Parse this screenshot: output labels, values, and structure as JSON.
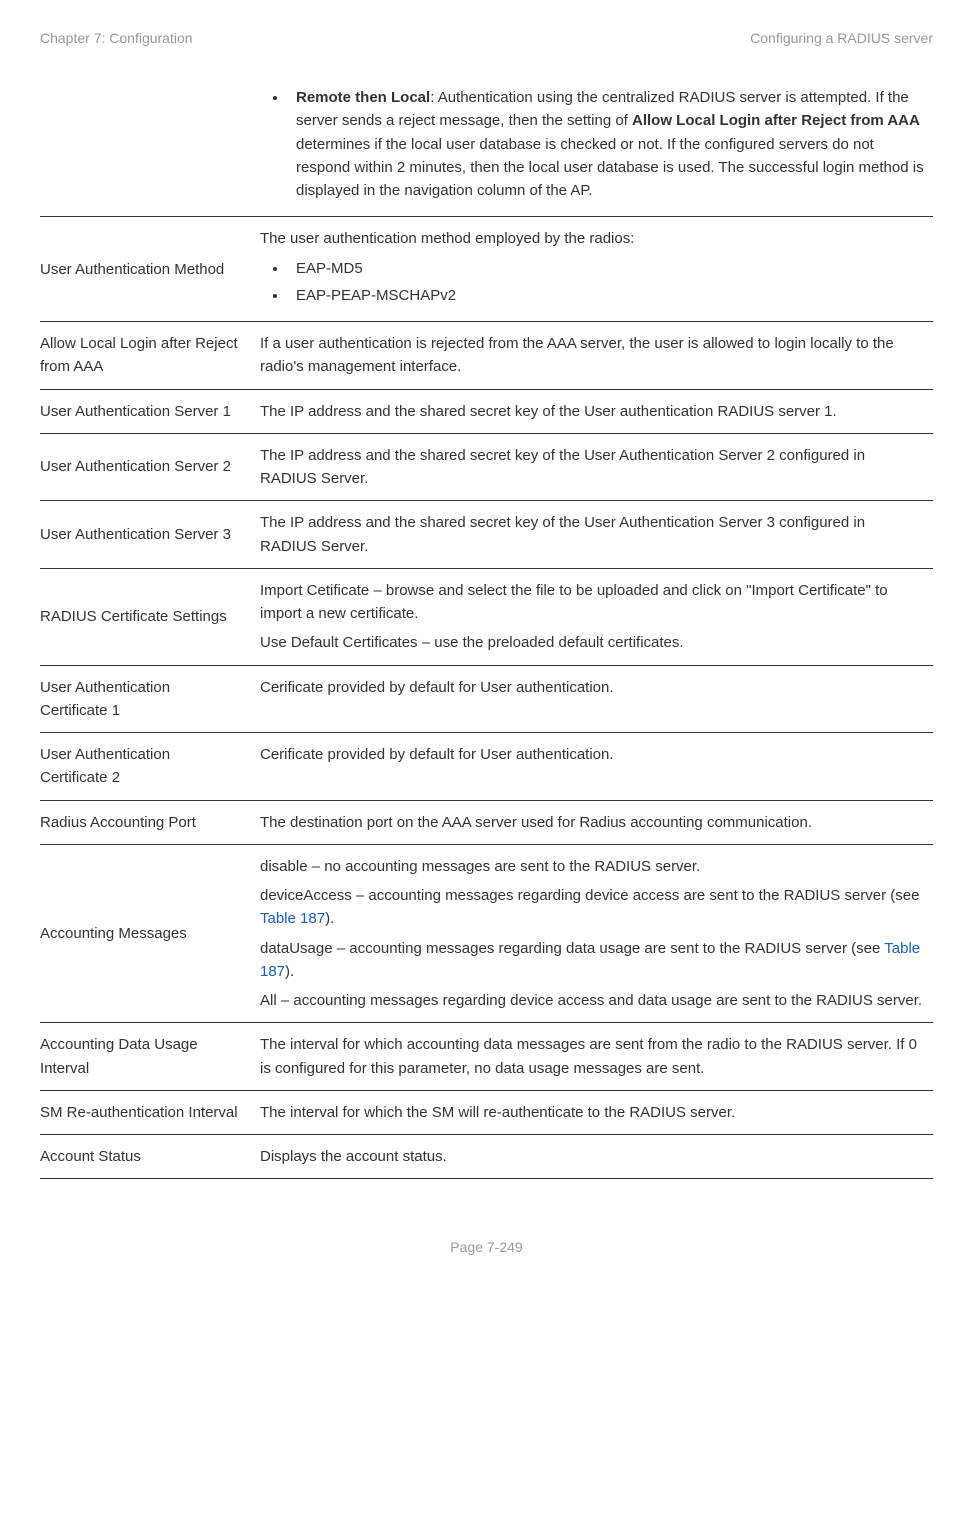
{
  "header": {
    "left": "Chapter 7:  Configuration",
    "right": "Configuring a RADIUS server"
  },
  "rows": {
    "r0": {
      "attr": "",
      "bullet_prefix_bold": "Remote then Local",
      "bullet_text": ": Authentication using the centralized RADIUS server is attempted. If the server sends a reject message, then the setting of ",
      "bullet_mid_bold": "Allow Local Login after Reject from AAA",
      "bullet_suffix": " determines if the local user database is checked or not. If the configured servers do not respond within 2 minutes, then the local user database is used. The successful login method is displayed in the navigation column of the AP."
    },
    "r1": {
      "attr": "User Authentication Method",
      "intro": "The user authentication method employed by the radios:",
      "b1": "EAP-MD5",
      "b2": "EAP-PEAP-MSCHAPv2"
    },
    "r2": {
      "attr": "Allow Local Login after Reject from AAA",
      "desc": "If a user authentication is rejected from the AAA server, the user is allowed to login locally to the radio's management interface."
    },
    "r3": {
      "attr": "User Authentication Server 1",
      "desc": "The IP address and the shared secret key of the User authentication RADIUS server 1."
    },
    "r4": {
      "attr": "User Authentication Server 2",
      "desc": "The IP address and the shared secret key of the User Authentication Server 2 configured in RADIUS Server."
    },
    "r5": {
      "attr": "User Authentication Server 3",
      "desc": "The IP address and the shared secret key of the User Authentication Server 3 configured in RADIUS Server."
    },
    "r6": {
      "attr": "RADIUS Certificate Settings",
      "p1": "Import Cetificate – browse and select the file to be uploaded and click on \"Import Certificate\" to import a new certificate.",
      "p2": "Use Default Certificates  –  use the preloaded default certificates."
    },
    "r7": {
      "attr": "User Authentication Certificate 1",
      "desc": "Cerificate provided by default for User authentication."
    },
    "r8": {
      "attr": "User Authentication Certificate 2",
      "desc": "Cerificate provided by default for User authentication."
    },
    "r9": {
      "attr": "Radius Accounting Port",
      "desc": "The destination port on the AAA server used for Radius accounting communication."
    },
    "r10": {
      "attr": "Accounting Messages",
      "p1": "disable – no accounting messages are sent to the RADIUS server.",
      "p2a": "deviceAccess – accounting messages regarding device access are sent to the RADIUS server (see ",
      "p2link": "Table 187",
      "p2b": ").",
      "p3a": "dataUsage – accounting messages regarding data usage are sent to the RADIUS server (see ",
      "p3link": "Table 187",
      "p3b": ").",
      "p4": "All – accounting messages regarding device access and data usage are sent to the RADIUS server."
    },
    "r11": {
      "attr": "Accounting Data Usage Interval",
      "desc": "The interval for which accounting data messages are sent from the radio to the RADIUS server. If 0 is configured for this parameter, no data usage messages are sent."
    },
    "r12": {
      "attr": "SM Re-authentication Interval",
      "desc": "The interval for which the SM will re-authenticate to the RADIUS server."
    },
    "r13": {
      "attr": "Account Status",
      "desc": "Displays the account status."
    }
  },
  "footer": "Page 7-249"
}
